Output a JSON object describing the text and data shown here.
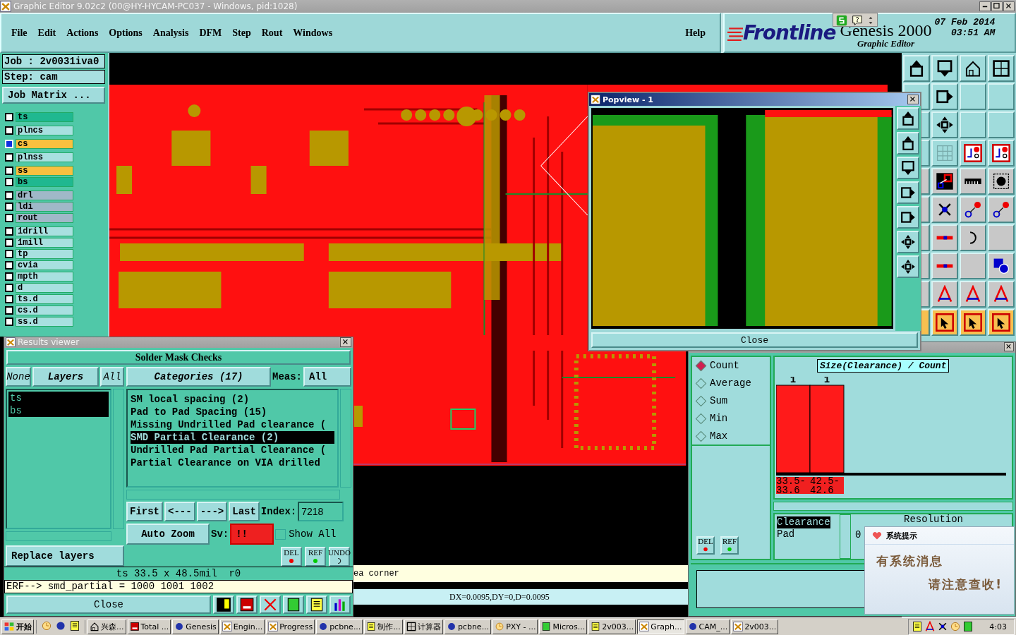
{
  "window": {
    "title": "Graphic Editor 9.02c2 (00@HY-HYCAM-PC037 - Windows, pid:1028)"
  },
  "menu": [
    {
      "label": "File"
    },
    {
      "label": "Edit"
    },
    {
      "label": "Actions"
    },
    {
      "label": "Options"
    },
    {
      "label": "Analysis"
    },
    {
      "label": "DFM"
    },
    {
      "label": "Step"
    },
    {
      "label": "Rout"
    },
    {
      "label": "Windows"
    }
  ],
  "help": "Help",
  "brand": {
    "logo": "Frontline",
    "product": "Genesis 2000",
    "subtitle": "Graphic Editor",
    "date": "07 Feb 2014",
    "time": "03:51 AM"
  },
  "job": {
    "job": "Job : 2v0031iva0",
    "step": "Step: cam",
    "matrix_button": "Job Matrix ..."
  },
  "layers": [
    {
      "name": "ts",
      "color": "#20b890",
      "selected": false
    },
    {
      "name": "plncs",
      "color": "#a8e0e0",
      "selected": false
    },
    {
      "name": "cs",
      "color": "#f8c040",
      "selected": true
    },
    {
      "name": "plnss",
      "color": "#a8e0e0",
      "selected": false
    },
    {
      "name": "ss",
      "color": "#f8c040",
      "selected": false
    },
    {
      "name": "bs",
      "color": "#20b890",
      "selected": false
    },
    {
      "name": "drl",
      "color": "#a0b8c8",
      "selected": false
    },
    {
      "name": "ldi",
      "color": "#a0b8c8",
      "selected": false
    },
    {
      "name": "rout",
      "color": "#a0b8c8",
      "selected": false
    },
    {
      "name": "1drill",
      "color": "#a8e0e0",
      "selected": false
    },
    {
      "name": "1mill",
      "color": "#a8e0e0",
      "selected": false
    },
    {
      "name": "tp",
      "color": "#a8e0e0",
      "selected": false
    },
    {
      "name": "cvia",
      "color": "#a8e0e0",
      "selected": false
    },
    {
      "name": "mpth",
      "color": "#a8e0e0",
      "selected": false
    },
    {
      "name": "d",
      "color": "#a8e0e0",
      "selected": false
    },
    {
      "name": "ts.d",
      "color": "#a8e0e0",
      "selected": false
    },
    {
      "name": "cs.d",
      "color": "#a8e0e0",
      "selected": false
    },
    {
      "name": "ss.d",
      "color": "#a8e0e0",
      "selected": false
    }
  ],
  "canvas": {
    "status_line": "ea corner",
    "measure": "DX=0.0095,DY=0,D=0.0095"
  },
  "popview": {
    "title": "Popview - 1",
    "close": "Close"
  },
  "results": {
    "title": "Results viewer",
    "header": "Solder Mask Checks",
    "layer_buttons": [
      "None",
      "Layers",
      "All"
    ],
    "layers": [
      {
        "name": "ts",
        "selected": true
      },
      {
        "name": "bs",
        "selected": true
      }
    ],
    "categories_button": "Categories (17)",
    "meas_label": "Meas:",
    "meas_value": "All",
    "categories": [
      {
        "label": "SM local spacing (2)",
        "selected": false
      },
      {
        "label": "Pad to Pad Spacing (15)",
        "selected": false
      },
      {
        "label": "Missing Undrilled Pad clearance (",
        "selected": false
      },
      {
        "label": "SMD Partial Clearance (2)",
        "selected": true
      },
      {
        "label": "Undrilled Pad Partial Clearance (",
        "selected": false
      },
      {
        "label": "Partial Clearance on VIA drilled",
        "selected": false
      }
    ],
    "nav": [
      "First",
      "<---",
      "--->",
      "Last"
    ],
    "index_label": "Index:",
    "index_value": "7218",
    "zoom": "Auto Zoom",
    "sv_label": "Sv:",
    "sv_value": "!!",
    "show_all": {
      "label": "Show All",
      "checked": false
    },
    "actions": [
      "DEL",
      "REF",
      "UNDO"
    ],
    "replace": "Replace layers",
    "info": "ts 33.5 x 48.5mil  r0",
    "erf": "ERF--> smd_partial = 1000 1001 1002",
    "close": "Close"
  },
  "stats": {
    "modes": [
      {
        "label": "Count",
        "selected": true
      },
      {
        "label": "Average",
        "selected": false
      },
      {
        "label": "Sum",
        "selected": false
      },
      {
        "label": "Min",
        "selected": false
      },
      {
        "label": "Max",
        "selected": false
      }
    ],
    "actions": [
      "DEL",
      "REF"
    ],
    "chart_data": {
      "type": "bar",
      "title": "Size(Clearance) / Count",
      "categories": [
        "33.5-33.6",
        "42.5-42.6"
      ],
      "values": [
        1,
        1
      ],
      "data_labels": true
    },
    "attributes": [
      {
        "label": "Clearance",
        "selected": true
      },
      {
        "label": "Pad",
        "selected": false
      }
    ],
    "resolution": "Resolution",
    "resolution_value": "0"
  },
  "popup": {
    "title": "系统提示",
    "line_1": "有系统消息",
    "line_2": "请注意查收!"
  },
  "taskbar": {
    "start": "开始",
    "items": [
      {
        "label": "兴森...",
        "selected": false
      },
      {
        "label": "Total ...",
        "selected": false
      },
      {
        "label": "Genesis",
        "selected": false
      },
      {
        "label": "Engin...",
        "selected": false
      },
      {
        "label": "Progress",
        "selected": false
      },
      {
        "label": "pcbne...",
        "selected": false
      },
      {
        "label": "制作...",
        "selected": false
      },
      {
        "label": "计算器",
        "selected": false
      },
      {
        "label": "pcbne...",
        "selected": false
      },
      {
        "label": "PXY - ...",
        "selected": false
      },
      {
        "label": "Micros...",
        "selected": false
      },
      {
        "label": "2v003...",
        "selected": false
      },
      {
        "label": "Graph...",
        "selected": true
      },
      {
        "label": "CAM_...",
        "selected": false
      },
      {
        "label": "2v003...",
        "selected": false
      }
    ],
    "clock": "4:03"
  }
}
